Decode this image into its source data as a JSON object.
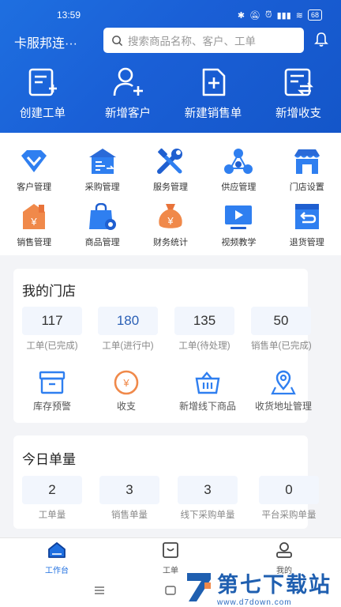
{
  "status": {
    "time": "13:59",
    "battery": "68"
  },
  "header": {
    "store_name": "卡服邦连···",
    "search_placeholder": "搜索商品名称、客户、工单",
    "quick_actions": [
      {
        "label": "创建工单",
        "icon": "create-order-icon"
      },
      {
        "label": "新增客户",
        "icon": "add-customer-icon"
      },
      {
        "label": "新建销售单",
        "icon": "new-sales-order-icon"
      },
      {
        "label": "新增收支",
        "icon": "add-income-expense-icon"
      }
    ]
  },
  "grid": {
    "row1": [
      {
        "label": "客户管理",
        "icon": "customer-management-icon"
      },
      {
        "label": "采购管理",
        "icon": "purchase-management-icon"
      },
      {
        "label": "服务管理",
        "icon": "service-management-icon"
      },
      {
        "label": "供应管理",
        "icon": "supply-management-icon"
      },
      {
        "label": "门店设置",
        "icon": "store-settings-icon"
      }
    ],
    "row2": [
      {
        "label": "销售管理",
        "icon": "sales-management-icon"
      },
      {
        "label": "商品管理",
        "icon": "product-management-icon"
      },
      {
        "label": "财务统计",
        "icon": "finance-stats-icon"
      },
      {
        "label": "视频教学",
        "icon": "video-tutorial-icon"
      },
      {
        "label": "退货管理",
        "icon": "returns-management-icon"
      }
    ]
  },
  "my_store": {
    "title": "我的门店",
    "stats": [
      {
        "value": "117",
        "label": "工单(已完成)"
      },
      {
        "value": "180",
        "label": "工单(进行中)"
      },
      {
        "value": "135",
        "label": "工单(待处理)"
      },
      {
        "value": "50",
        "label": "销售单(已完成)"
      }
    ],
    "tools": [
      {
        "label": "库存预警",
        "icon": "inventory-alert-icon"
      },
      {
        "label": "收支",
        "icon": "income-expense-icon"
      },
      {
        "label": "新增线下商品",
        "icon": "add-offline-product-icon"
      },
      {
        "label": "收货地址管理",
        "icon": "address-management-icon"
      }
    ]
  },
  "today": {
    "title": "今日单量",
    "stats": [
      {
        "value": "2",
        "label": "工单量"
      },
      {
        "value": "3",
        "label": "销售单量"
      },
      {
        "value": "3",
        "label": "线下采购单量"
      },
      {
        "value": "0",
        "label": "平台采购单量"
      }
    ]
  },
  "bottom_nav": [
    {
      "label": "工作台",
      "icon": "workbench-icon",
      "active": true
    },
    {
      "label": "工单",
      "icon": "work-order-icon",
      "active": false
    },
    {
      "label": "我的",
      "icon": "profile-icon",
      "active": false
    }
  ],
  "watermark": {
    "title": "第七下载站",
    "url": "www.d7down.com"
  },
  "colors": {
    "primary": "#1f6fe0",
    "header_start": "#1e6fe0",
    "header_end": "#1456c9",
    "stat_bg": "#f2f6fd"
  }
}
